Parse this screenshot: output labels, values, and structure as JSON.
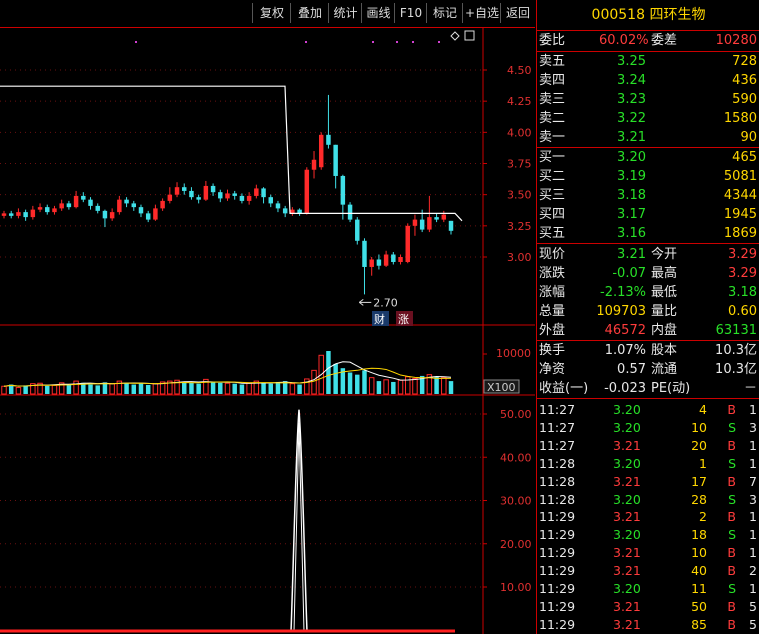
{
  "toolbar": {
    "buttons": [
      "复权",
      "叠加",
      "统计",
      "画线",
      "F10",
      "标记",
      "+自选",
      "返回"
    ]
  },
  "stock": {
    "code": "000518",
    "name": "四环生物"
  },
  "weibi": {
    "label": "委比",
    "value": "60.02%",
    "cha_label": "委差",
    "cha_value": "10280"
  },
  "asks": [
    {
      "label": "卖五",
      "price": "3.25",
      "vol": "728"
    },
    {
      "label": "卖四",
      "price": "3.24",
      "vol": "436"
    },
    {
      "label": "卖三",
      "price": "3.23",
      "vol": "590"
    },
    {
      "label": "卖二",
      "price": "3.22",
      "vol": "1580"
    },
    {
      "label": "卖一",
      "price": "3.21",
      "vol": "90"
    }
  ],
  "bids": [
    {
      "label": "买一",
      "price": "3.20",
      "vol": "465"
    },
    {
      "label": "买二",
      "price": "3.19",
      "vol": "5081"
    },
    {
      "label": "买三",
      "price": "3.18",
      "vol": "4344"
    },
    {
      "label": "买四",
      "price": "3.17",
      "vol": "1945"
    },
    {
      "label": "买五",
      "price": "3.16",
      "vol": "1869"
    }
  ],
  "quote": [
    {
      "l1": "现价",
      "v1": "3.21",
      "c1": "c-g",
      "l2": "今开",
      "v2": "3.29",
      "c2": "c-r"
    },
    {
      "l1": "涨跌",
      "v1": "-0.07",
      "c1": "c-g",
      "l2": "最高",
      "v2": "3.29",
      "c2": "c-r"
    },
    {
      "l1": "涨幅",
      "v1": "-2.13%",
      "c1": "c-g",
      "l2": "最低",
      "v2": "3.18",
      "c2": "c-g"
    },
    {
      "l1": "总量",
      "v1": "109703",
      "c1": "c-y",
      "l2": "量比",
      "v2": "0.60",
      "c2": "c-y"
    },
    {
      "l1": "外盘",
      "v1": "46572",
      "c1": "c-r",
      "l2": "内盘",
      "v2": "63131",
      "c2": "c-g"
    }
  ],
  "fund": [
    {
      "l1": "换手",
      "v1": "1.07%",
      "l2": "股本",
      "v2": "10.3亿"
    },
    {
      "l1": "净资",
      "v1": "0.57",
      "l2": "流通",
      "v2": "10.3亿"
    },
    {
      "l1": "收益(一)",
      "v1": "-0.023",
      "l2": "PE(动)",
      "v2": "－"
    }
  ],
  "ticks": [
    {
      "time": "11:27",
      "price": "3.20",
      "vol": "4",
      "side": "B",
      "n": "1"
    },
    {
      "time": "11:27",
      "price": "3.20",
      "vol": "10",
      "side": "S",
      "n": "3"
    },
    {
      "time": "11:27",
      "price": "3.21",
      "vol": "20",
      "side": "B",
      "n": "1"
    },
    {
      "time": "11:28",
      "price": "3.20",
      "vol": "1",
      "side": "S",
      "n": "1"
    },
    {
      "time": "11:28",
      "price": "3.21",
      "vol": "17",
      "side": "B",
      "n": "7"
    },
    {
      "time": "11:28",
      "price": "3.20",
      "vol": "28",
      "side": "S",
      "n": "3"
    },
    {
      "time": "11:29",
      "price": "3.21",
      "vol": "2",
      "side": "B",
      "n": "1"
    },
    {
      "time": "11:29",
      "price": "3.20",
      "vol": "18",
      "side": "S",
      "n": "1"
    },
    {
      "time": "11:29",
      "price": "3.21",
      "vol": "10",
      "side": "B",
      "n": "1"
    },
    {
      "time": "11:29",
      "price": "3.21",
      "vol": "40",
      "side": "B",
      "n": "2"
    },
    {
      "time": "11:29",
      "price": "3.20",
      "vol": "11",
      "side": "S",
      "n": "1"
    },
    {
      "time": "11:29",
      "price": "3.21",
      "vol": "50",
      "side": "B",
      "n": "5"
    },
    {
      "time": "11:29",
      "price": "3.21",
      "vol": "85",
      "side": "B",
      "n": "5"
    }
  ],
  "chart_data": {
    "type": "candlestick",
    "price_axis": {
      "ticks": [
        "4.50",
        "4.25",
        "4.00",
        "3.75",
        "3.50",
        "3.25",
        "3.00"
      ],
      "min": 2.6,
      "max": 4.75
    },
    "volume_axis": {
      "ticks": [
        "10000"
      ],
      "unit_label": "X100"
    },
    "indicator_axis": {
      "ticks": [
        "50.00",
        "40.00",
        "30.00",
        "20.00",
        "10.00"
      ],
      "min": 0,
      "max": 52
    },
    "low_annotation": "2.70",
    "badges": [
      "财",
      "涨"
    ],
    "candles": [
      {
        "o": 3.33,
        "c": 3.35,
        "h": 3.37,
        "l": 3.31
      },
      {
        "o": 3.35,
        "c": 3.33,
        "h": 3.37,
        "l": 3.31
      },
      {
        "o": 3.33,
        "c": 3.36,
        "h": 3.39,
        "l": 3.31
      },
      {
        "o": 3.36,
        "c": 3.32,
        "h": 3.38,
        "l": 3.29
      },
      {
        "o": 3.32,
        "c": 3.38,
        "h": 3.41,
        "l": 3.3
      },
      {
        "o": 3.38,
        "c": 3.4,
        "h": 3.43,
        "l": 3.36
      },
      {
        "o": 3.4,
        "c": 3.36,
        "h": 3.42,
        "l": 3.34
      },
      {
        "o": 3.36,
        "c": 3.39,
        "h": 3.41,
        "l": 3.34
      },
      {
        "o": 3.39,
        "c": 3.43,
        "h": 3.46,
        "l": 3.37
      },
      {
        "o": 3.43,
        "c": 3.4,
        "h": 3.45,
        "l": 3.38
      },
      {
        "o": 3.4,
        "c": 3.49,
        "h": 3.53,
        "l": 3.39
      },
      {
        "o": 3.49,
        "c": 3.46,
        "h": 3.52,
        "l": 3.44
      },
      {
        "o": 3.46,
        "c": 3.41,
        "h": 3.48,
        "l": 3.38
      },
      {
        "o": 3.41,
        "c": 3.37,
        "h": 3.43,
        "l": 3.35
      },
      {
        "o": 3.37,
        "c": 3.31,
        "h": 3.38,
        "l": 3.24
      },
      {
        "o": 3.31,
        "c": 3.36,
        "h": 3.39,
        "l": 3.29
      },
      {
        "o": 3.36,
        "c": 3.46,
        "h": 3.49,
        "l": 3.34
      },
      {
        "o": 3.46,
        "c": 3.43,
        "h": 3.48,
        "l": 3.4
      },
      {
        "o": 3.43,
        "c": 3.4,
        "h": 3.45,
        "l": 3.37
      },
      {
        "o": 3.4,
        "c": 3.35,
        "h": 3.42,
        "l": 3.32
      },
      {
        "o": 3.35,
        "c": 3.3,
        "h": 3.37,
        "l": 3.28
      },
      {
        "o": 3.3,
        "c": 3.39,
        "h": 3.42,
        "l": 3.29
      },
      {
        "o": 3.39,
        "c": 3.45,
        "h": 3.47,
        "l": 3.37
      },
      {
        "o": 3.45,
        "c": 3.5,
        "h": 3.56,
        "l": 3.43
      },
      {
        "o": 3.5,
        "c": 3.56,
        "h": 3.6,
        "l": 3.48
      },
      {
        "o": 3.56,
        "c": 3.53,
        "h": 3.59,
        "l": 3.5
      },
      {
        "o": 3.53,
        "c": 3.48,
        "h": 3.56,
        "l": 3.46
      },
      {
        "o": 3.48,
        "c": 3.46,
        "h": 3.5,
        "l": 3.43
      },
      {
        "o": 3.46,
        "c": 3.57,
        "h": 3.61,
        "l": 3.45
      },
      {
        "o": 3.57,
        "c": 3.52,
        "h": 3.59,
        "l": 3.49
      },
      {
        "o": 3.52,
        "c": 3.47,
        "h": 3.54,
        "l": 3.44
      },
      {
        "o": 3.47,
        "c": 3.51,
        "h": 3.54,
        "l": 3.45
      },
      {
        "o": 3.51,
        "c": 3.49,
        "h": 3.53,
        "l": 3.46
      },
      {
        "o": 3.49,
        "c": 3.45,
        "h": 3.51,
        "l": 3.43
      },
      {
        "o": 3.45,
        "c": 3.49,
        "h": 3.52,
        "l": 3.42
      },
      {
        "o": 3.49,
        "c": 3.55,
        "h": 3.58,
        "l": 3.47
      },
      {
        "o": 3.55,
        "c": 3.48,
        "h": 3.56,
        "l": 3.43
      },
      {
        "o": 3.48,
        "c": 3.43,
        "h": 3.5,
        "l": 3.4
      },
      {
        "o": 3.43,
        "c": 3.39,
        "h": 3.45,
        "l": 3.36
      },
      {
        "o": 3.39,
        "c": 3.35,
        "h": 3.41,
        "l": 3.32
      },
      {
        "o": 3.35,
        "c": 3.38,
        "h": 3.4,
        "l": 3.33
      },
      {
        "o": 3.38,
        "c": 3.35,
        "h": 3.39,
        "l": 3.33
      },
      {
        "o": 3.35,
        "c": 3.7,
        "h": 3.72,
        "l": 3.34
      },
      {
        "o": 3.7,
        "c": 3.78,
        "h": 3.85,
        "l": 3.63
      },
      {
        "o": 3.72,
        "c": 3.98,
        "h": 4.0,
        "l": 3.7
      },
      {
        "o": 3.98,
        "c": 3.9,
        "h": 4.3,
        "l": 3.87
      },
      {
        "o": 3.9,
        "c": 3.65,
        "h": 3.9,
        "l": 3.55
      },
      {
        "o": 3.65,
        "c": 3.42,
        "h": 3.66,
        "l": 3.3
      },
      {
        "o": 3.42,
        "c": 3.3,
        "h": 3.44,
        "l": 3.28
      },
      {
        "o": 3.3,
        "c": 3.13,
        "h": 3.32,
        "l": 3.1
      },
      {
        "o": 3.13,
        "c": 2.92,
        "h": 3.15,
        "l": 2.7
      },
      {
        "o": 2.92,
        "c": 2.98,
        "h": 3.0,
        "l": 2.85
      },
      {
        "o": 2.98,
        "c": 2.93,
        "h": 3.02,
        "l": 2.9
      },
      {
        "o": 2.93,
        "c": 3.02,
        "h": 3.05,
        "l": 2.92
      },
      {
        "o": 3.02,
        "c": 2.96,
        "h": 3.04,
        "l": 2.94
      },
      {
        "o": 2.96,
        "c": 3.0,
        "h": 3.02,
        "l": 2.94
      },
      {
        "o": 2.96,
        "c": 3.25,
        "h": 3.27,
        "l": 2.95
      },
      {
        "o": 3.25,
        "c": 3.3,
        "h": 3.34,
        "l": 3.17
      },
      {
        "o": 3.3,
        "c": 3.22,
        "h": 3.38,
        "l": 3.2
      },
      {
        "o": 3.22,
        "c": 3.32,
        "h": 3.49,
        "l": 3.2
      },
      {
        "o": 3.32,
        "c": 3.3,
        "h": 3.35,
        "l": 3.28
      },
      {
        "o": 3.3,
        "c": 3.34,
        "h": 3.37,
        "l": 3.28
      },
      {
        "o": 3.29,
        "c": 3.21,
        "h": 3.29,
        "l": 3.18
      }
    ],
    "volumes": [
      18,
      22,
      15,
      20,
      24,
      25,
      19,
      20,
      26,
      23,
      30,
      26,
      22,
      20,
      27,
      24,
      30,
      25,
      22,
      26,
      21,
      24,
      28,
      30,
      32,
      28,
      26,
      24,
      34,
      28,
      26,
      25,
      24,
      22,
      26,
      30,
      26,
      24,
      28,
      30,
      24,
      22,
      35,
      55,
      90,
      100,
      70,
      60,
      50,
      45,
      55,
      38,
      30,
      33,
      28,
      32,
      40,
      36,
      42,
      45,
      40,
      38,
      30
    ]
  }
}
